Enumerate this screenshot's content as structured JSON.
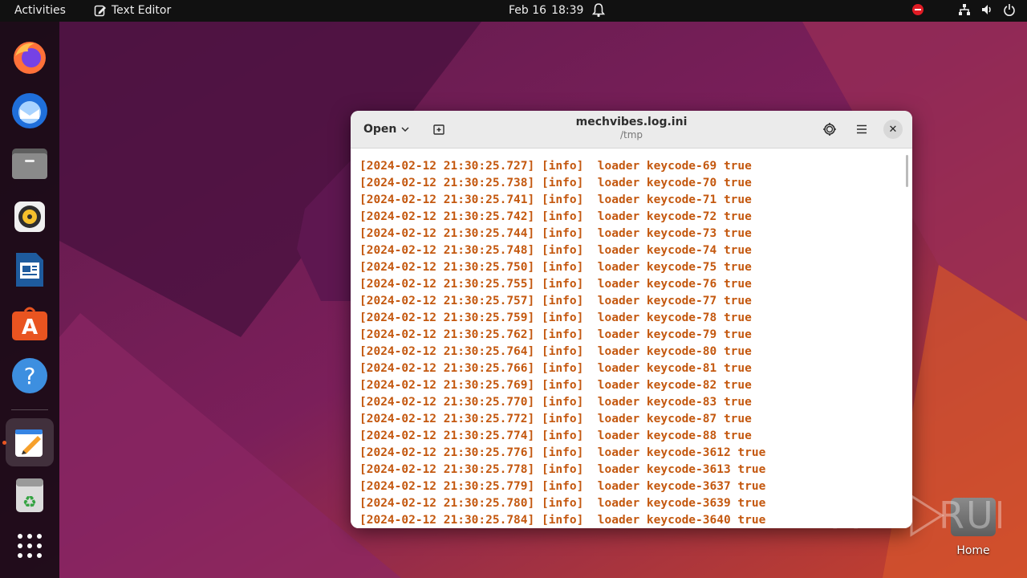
{
  "topbar": {
    "activities": "Activities",
    "app_name": "Text Editor",
    "date": "Feb 16",
    "time": "18:39"
  },
  "dock": {
    "items": [
      "firefox",
      "thunderbird",
      "files",
      "rhythmbox",
      "libreoffice-writer",
      "app-center",
      "help",
      "text-editor",
      "trash",
      "show-apps"
    ]
  },
  "window": {
    "open_label": "Open",
    "title": "mechvibes.log.ini",
    "subtitle": "/tmp",
    "lines": [
      "[2024-02-12 21:30:25.727] [info]  loader keycode-69 true",
      "[2024-02-12 21:30:25.738] [info]  loader keycode-70 true",
      "[2024-02-12 21:30:25.741] [info]  loader keycode-71 true",
      "[2024-02-12 21:30:25.742] [info]  loader keycode-72 true",
      "[2024-02-12 21:30:25.744] [info]  loader keycode-73 true",
      "[2024-02-12 21:30:25.748] [info]  loader keycode-74 true",
      "[2024-02-12 21:30:25.750] [info]  loader keycode-75 true",
      "[2024-02-12 21:30:25.755] [info]  loader keycode-76 true",
      "[2024-02-12 21:30:25.757] [info]  loader keycode-77 true",
      "[2024-02-12 21:30:25.759] [info]  loader keycode-78 true",
      "[2024-02-12 21:30:25.762] [info]  loader keycode-79 true",
      "[2024-02-12 21:30:25.764] [info]  loader keycode-80 true",
      "[2024-02-12 21:30:25.766] [info]  loader keycode-81 true",
      "[2024-02-12 21:30:25.769] [info]  loader keycode-82 true",
      "[2024-02-12 21:30:25.770] [info]  loader keycode-83 true",
      "[2024-02-12 21:30:25.772] [info]  loader keycode-87 true",
      "[2024-02-12 21:30:25.774] [info]  loader keycode-88 true",
      "[2024-02-12 21:30:25.776] [info]  loader keycode-3612 true",
      "[2024-02-12 21:30:25.778] [info]  loader keycode-3613 true",
      "[2024-02-12 21:30:25.779] [info]  loader keycode-3637 true",
      "[2024-02-12 21:30:25.780] [info]  loader keycode-3639 true",
      "[2024-02-12 21:30:25.784] [info]  loader keycode-3640 true"
    ]
  },
  "desktop": {
    "home_label": "Home",
    "watermark": "ANY RUN"
  },
  "colors": {
    "log_text": "#c4580f",
    "accent": "#e95420"
  }
}
